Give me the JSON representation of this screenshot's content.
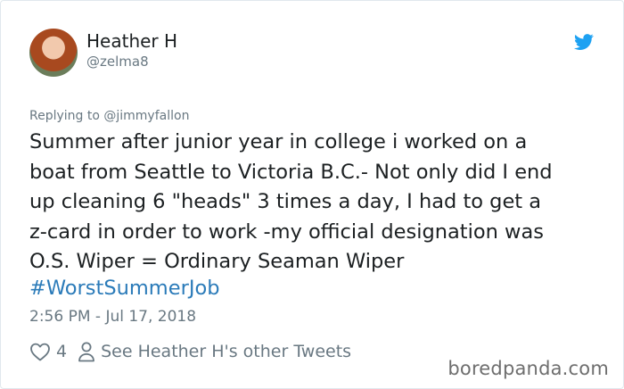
{
  "tweet": {
    "author_name": "Heather H",
    "author_handle": "@zelma8",
    "replying_to": "Replying to @jimmyfallon",
    "text": "Summer after junior year in college i worked on a\nboat from Seattle to Victoria B.C.- Not only did I end\nup cleaning 6 \"heads\" 3 times a day, I had to get a\nz-card in order to work -my official designation was\nO.S. Wiper = Ordinary Seaman Wiper",
    "hashtag": "#WorstSummerJob",
    "timestamp": "2:56 PM - Jul 17, 2018",
    "like_count": "4",
    "see_more": "See Heather H's other Tweets"
  },
  "icons": {
    "brand": "twitter-bird-icon",
    "like": "heart-icon",
    "profile": "person-icon"
  },
  "colors": {
    "twitter_blue": "#1da1f2",
    "link": "#2b7bb9",
    "muted": "#697882"
  },
  "watermark": "boredpanda.com"
}
